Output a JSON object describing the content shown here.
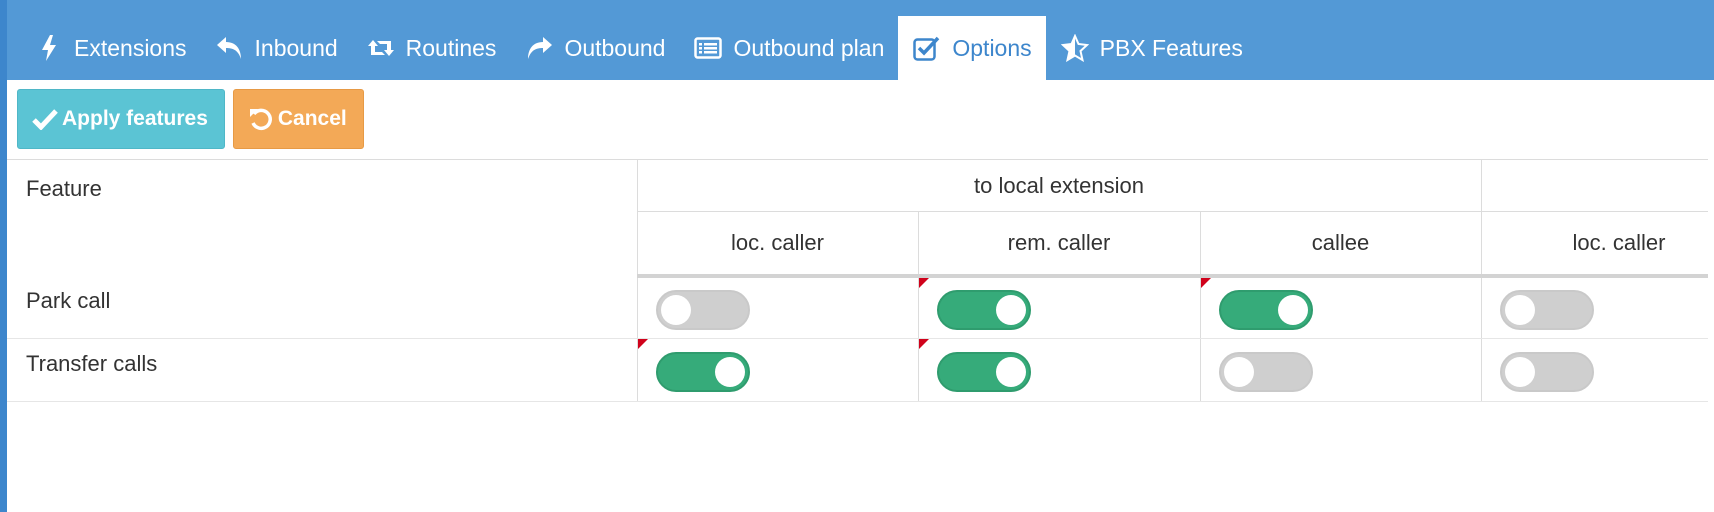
{
  "tabs": [
    {
      "label": "Extensions",
      "icon": "bolt-icon",
      "active": false
    },
    {
      "label": "Inbound",
      "icon": "reply-icon",
      "active": false
    },
    {
      "label": "Routines",
      "icon": "retweet-icon",
      "active": false
    },
    {
      "label": "Outbound",
      "icon": "share-icon",
      "active": false
    },
    {
      "label": "Outbound plan",
      "icon": "list-alt-icon",
      "active": false
    },
    {
      "label": "Options",
      "icon": "check-square-icon",
      "active": true
    },
    {
      "label": "PBX Features",
      "icon": "star-half-icon",
      "active": false
    }
  ],
  "toolbar": {
    "apply_label": "Apply features",
    "cancel_label": "Cancel"
  },
  "table": {
    "feature_header": "Feature",
    "group_header": "to local extension",
    "subheaders": [
      "loc. caller",
      "rem. caller",
      "callee",
      "loc. caller"
    ],
    "rows": [
      {
        "feature": "Park call",
        "toggles": [
          false,
          true,
          true,
          false
        ],
        "changed": [
          false,
          true,
          true,
          false
        ]
      },
      {
        "feature": "Transfer calls",
        "toggles": [
          true,
          true,
          false,
          false
        ],
        "changed": [
          true,
          true,
          false,
          false
        ]
      }
    ]
  },
  "colors": {
    "tabbar": "#5399d6",
    "active_tab_text": "#3d86cc",
    "apply_button": "#5bc4d4",
    "cancel_button": "#f3a957",
    "toggle_on": "#36ab7a",
    "toggle_off": "#cfcfcf",
    "changed_marker": "#d0021b"
  }
}
